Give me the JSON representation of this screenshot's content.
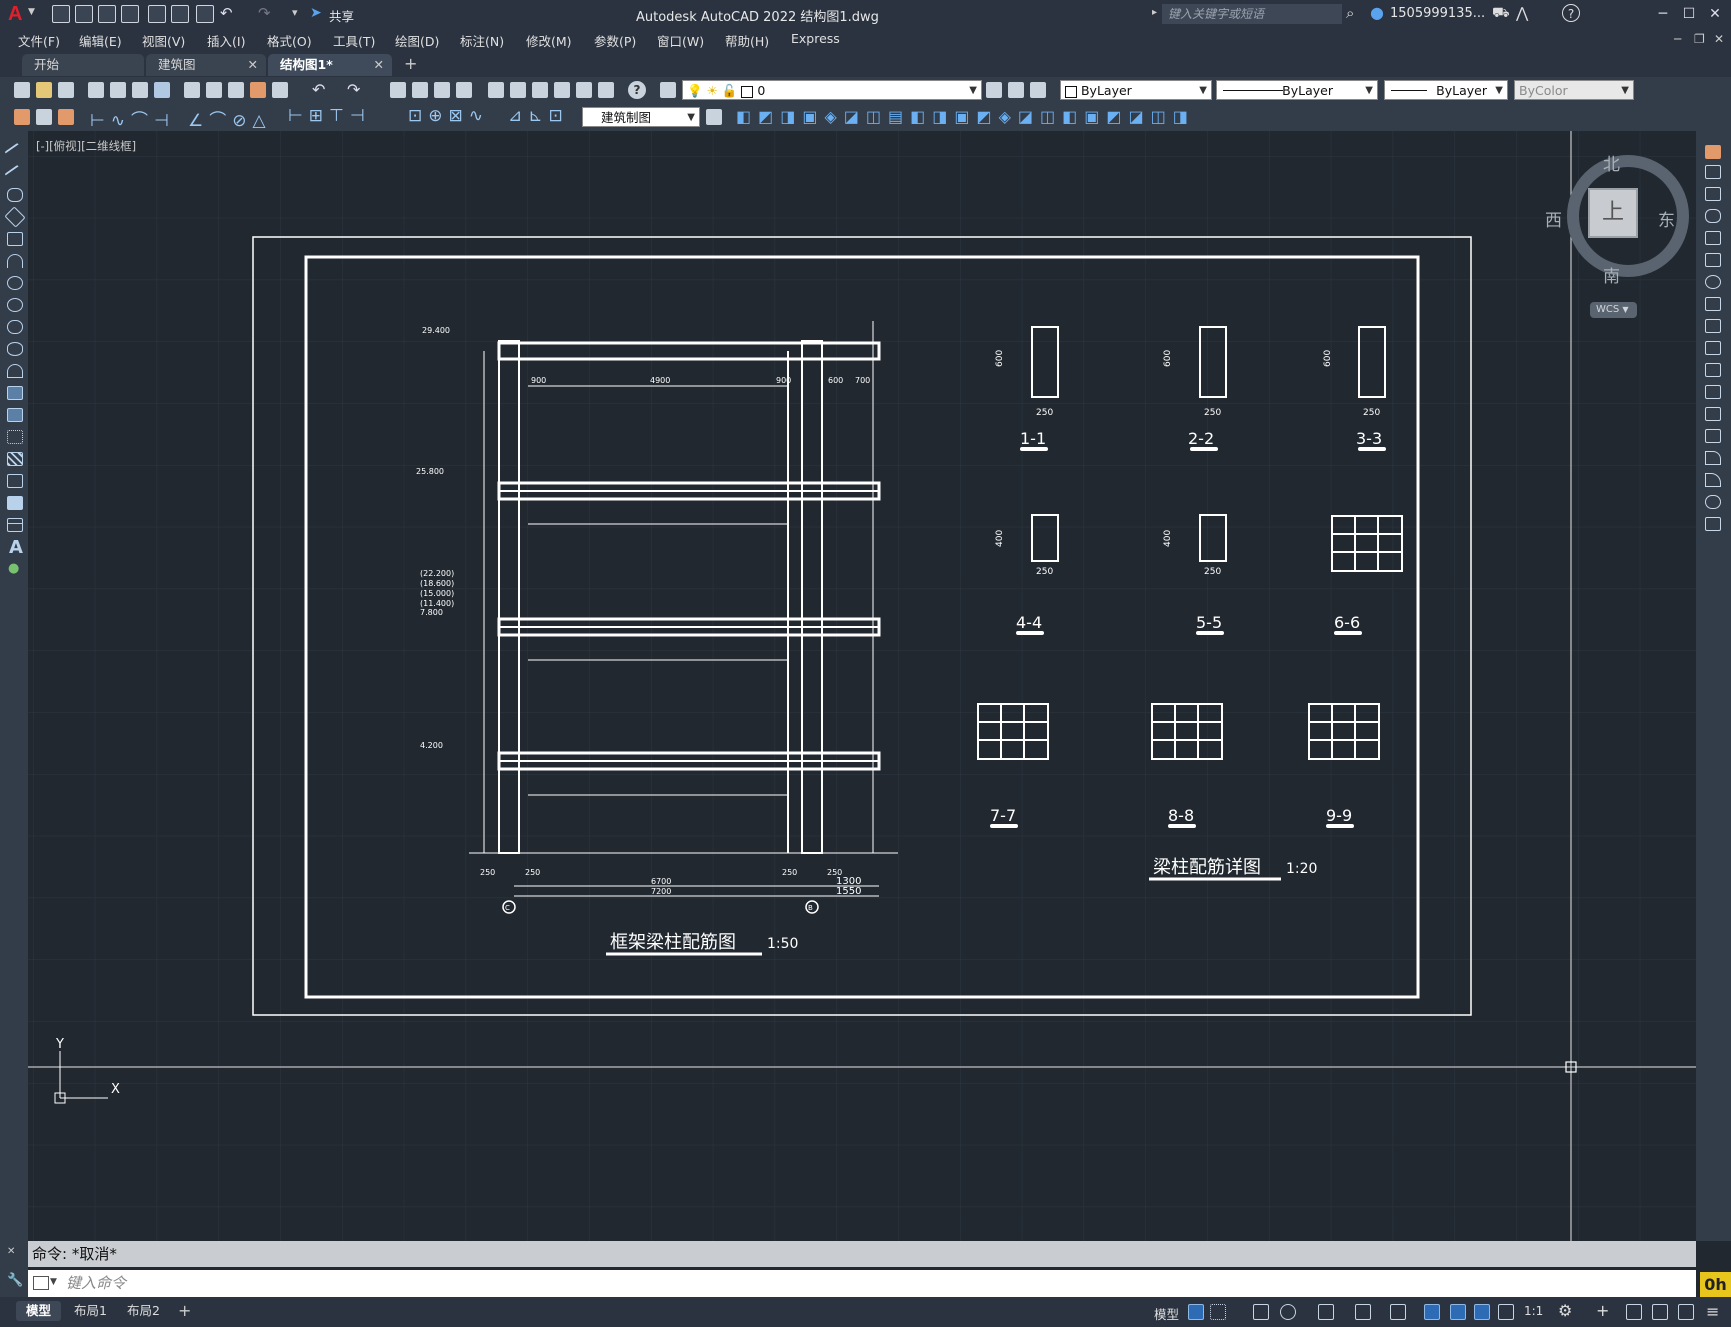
{
  "titlebar": {
    "app_letter": "A",
    "title": "Autodesk AutoCAD 2022    结构图1.dwg",
    "share_label": "共享",
    "search_placeholder": "键入关键字或短语",
    "user": "1505999135...",
    "help": "?"
  },
  "menu": [
    "文件(F)",
    "编辑(E)",
    "视图(V)",
    "插入(I)",
    "格式(O)",
    "工具(T)",
    "绘图(D)",
    "标注(N)",
    "修改(M)",
    "参数(P)",
    "窗口(W)",
    "帮助(H)",
    "Express"
  ],
  "tabs": [
    {
      "label": "开始",
      "active": false,
      "closable": false
    },
    {
      "label": "建筑图",
      "active": false,
      "closable": true
    },
    {
      "label": "结构图1*",
      "active": true,
      "closable": true
    }
  ],
  "toolbar": {
    "layer_value": "0",
    "color_value": "ByLayer",
    "linetype_value": "ByLayer",
    "lineweight_value": "ByLayer",
    "plotstyle_value": "ByColor",
    "dimstyle_value": "建筑制图"
  },
  "viewport": {
    "label": "[-][俯视][二维线框]",
    "viewcube": {
      "north": "北",
      "south": "南",
      "east": "东",
      "west": "西",
      "face": "上",
      "wcs": "WCS"
    },
    "ucs": {
      "x": "X",
      "y": "Y"
    }
  },
  "drawing": {
    "frame_title": "框架梁柱配筋图",
    "frame_scale": "1:50",
    "detail_title": "梁柱配筋详图",
    "detail_scale": "1:20",
    "sections": [
      "1-1",
      "2-2",
      "3-3",
      "4-4",
      "5-5",
      "6-6",
      "7-7",
      "8-8",
      "9-9"
    ],
    "elevations": [
      "29.400",
      "25.800",
      "7.800",
      "4.200"
    ],
    "elevation_stack": [
      "(22.200)",
      "(18.600)",
      "(15.000)",
      "(11.400)"
    ],
    "spans": [
      "900",
      "4900",
      "900",
      "600",
      "700"
    ],
    "bottom_dims": [
      "250",
      "250",
      "6700",
      "7200",
      "250",
      "250",
      "1300",
      "1550"
    ],
    "axis_marks": [
      "C",
      "B"
    ],
    "section_dims": {
      "width": "250",
      "depth_a": "600",
      "depth_b": "400"
    }
  },
  "command": {
    "history": "命令: *取消*",
    "input_placeholder": "键入命令"
  },
  "status": {
    "tabs": [
      "模型",
      "布局1",
      "布局2"
    ],
    "model_label": "模型",
    "scale": "1:1"
  }
}
